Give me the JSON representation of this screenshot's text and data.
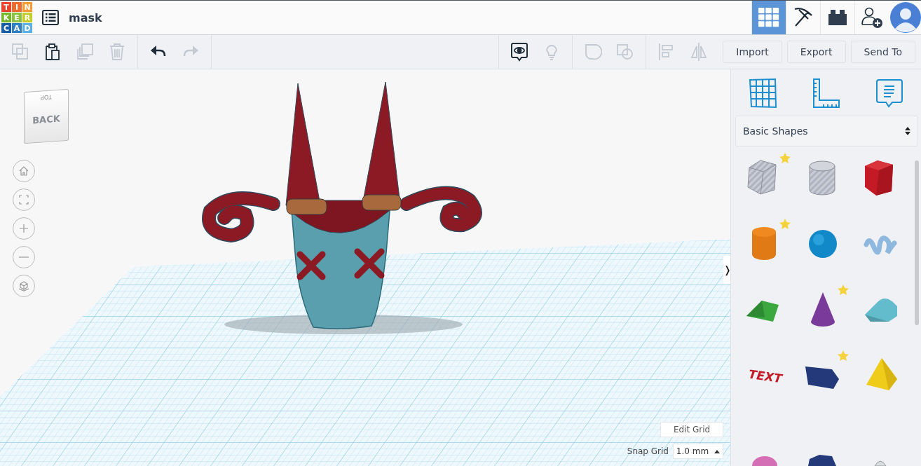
{
  "logo": {
    "letters": [
      {
        "text": "T",
        "color": "#e9452e"
      },
      {
        "text": "I",
        "color": "#f16a2c"
      },
      {
        "text": "N",
        "color": "#f49b35"
      },
      {
        "text": "K",
        "color": "#74b72a"
      },
      {
        "text": "E",
        "color": "#8ac43e"
      },
      {
        "text": "R",
        "color": "#c4cc2e"
      },
      {
        "text": "C",
        "color": "#1a5da6"
      },
      {
        "text": "A",
        "color": "#2e7fc4"
      },
      {
        "text": "D",
        "color": "#5cafe0"
      }
    ]
  },
  "title": "mask",
  "header_buttons": [
    {
      "kind": "grid",
      "selected": true
    },
    {
      "kind": "pickaxe",
      "selected": false
    },
    {
      "kind": "brick",
      "selected": false
    },
    {
      "kind": "add-user",
      "selected": false
    }
  ],
  "toolbar": {
    "edit_tools": [
      {
        "kind": "copy",
        "disabled": true
      },
      {
        "kind": "paste",
        "disabled": false
      },
      {
        "kind": "duplicate",
        "disabled": true
      },
      {
        "kind": "delete",
        "disabled": true
      }
    ],
    "history_tools": [
      {
        "kind": "undo",
        "disabled": false
      },
      {
        "kind": "redo",
        "disabled": true
      }
    ],
    "view_tools": [
      {
        "kind": "notes",
        "disabled": false
      },
      {
        "kind": "bulb",
        "disabled": true
      }
    ],
    "shape_tools": [
      {
        "kind": "group",
        "disabled": true
      },
      {
        "kind": "ungroup",
        "disabled": true
      }
    ],
    "arrange_tools": [
      {
        "kind": "align",
        "disabled": true
      },
      {
        "kind": "mirror",
        "disabled": true
      }
    ],
    "actions": [
      "Import",
      "Export",
      "Send To"
    ]
  },
  "view_cube": {
    "top": "TOP",
    "front": "BACK"
  },
  "view_controls": [
    {
      "kind": "home"
    },
    {
      "kind": "fit"
    },
    {
      "kind": "zoom-in"
    },
    {
      "kind": "zoom-out"
    },
    {
      "kind": "ortho"
    }
  ],
  "panel_toggle": "❭",
  "grid_controls": {
    "edit": "Edit Grid",
    "snap_label": "Snap Grid",
    "snap_value": "1.0 mm"
  },
  "panel": {
    "tools": [
      {
        "kind": "grid"
      },
      {
        "kind": "ruler"
      },
      {
        "kind": "notes"
      }
    ],
    "category": "Basic Shapes",
    "shapes": [
      {
        "kind": "box-hole",
        "starred": true
      },
      {
        "kind": "cylinder-hole",
        "starred": false
      },
      {
        "kind": "box",
        "starred": false
      },
      {
        "kind": "cylinder",
        "starred": true
      },
      {
        "kind": "sphere",
        "starred": false
      },
      {
        "kind": "scribble",
        "starred": false
      },
      {
        "kind": "roof",
        "starred": false
      },
      {
        "kind": "cone",
        "starred": true
      },
      {
        "kind": "round-roof",
        "starred": false
      },
      {
        "kind": "text",
        "starred": false,
        "text": "TEXT"
      },
      {
        "kind": "polygon",
        "starred": true
      },
      {
        "kind": "pyramid",
        "starred": false
      },
      {
        "kind": "dome",
        "starred": false
      },
      {
        "kind": "hexagon",
        "starred": false
      },
      {
        "kind": "paraboloid",
        "starred": false
      }
    ]
  }
}
